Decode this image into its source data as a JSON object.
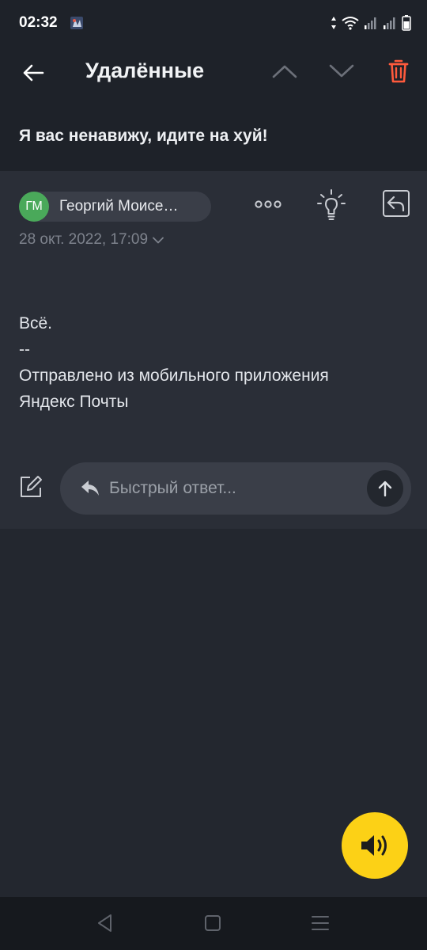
{
  "status_bar": {
    "time": "02:32",
    "app_icon": "game-app-icon",
    "icons": [
      "data-arrows-icon",
      "wifi-icon",
      "signal-icon",
      "signal-icon",
      "battery-icon"
    ]
  },
  "toolbar": {
    "back_icon": "arrow-left-icon",
    "title": "Удалённые",
    "prev_icon": "chevron-up-icon",
    "next_icon": "chevron-down-icon",
    "delete_icon": "trash-icon"
  },
  "message": {
    "subject": "Я вас ненавижу, идите на хуй!",
    "sender": {
      "initials": "ГМ",
      "name": "Георгий Моисе…"
    },
    "date": "28 окт. 2022, 17:09",
    "actions": {
      "more_icon": "more-dots-icon",
      "bulb_icon": "lightbulb-icon",
      "reply_all_icon": "reply-all-icon"
    },
    "body_lines": [
      "Всё.",
      "--",
      "Отправлено из мобильного приложения",
      "Яндекс Почты"
    ]
  },
  "quick_reply": {
    "compose_icon": "compose-icon",
    "reply_icon": "reply-arrow-icon",
    "placeholder": "Быстрый ответ...",
    "send_icon": "arrow-up-icon"
  },
  "fab": {
    "icon": "speaker-icon"
  },
  "colors": {
    "accent_trash": "#ff5a3c",
    "fab_yellow": "#fcd116",
    "avatar_green": "#4aa95a",
    "background": "#23272f",
    "card": "#2a2e37"
  },
  "system_nav": {
    "back_icon": "triangle-back-icon",
    "home_icon": "square-home-icon",
    "recents_icon": "menu-lines-icon"
  }
}
